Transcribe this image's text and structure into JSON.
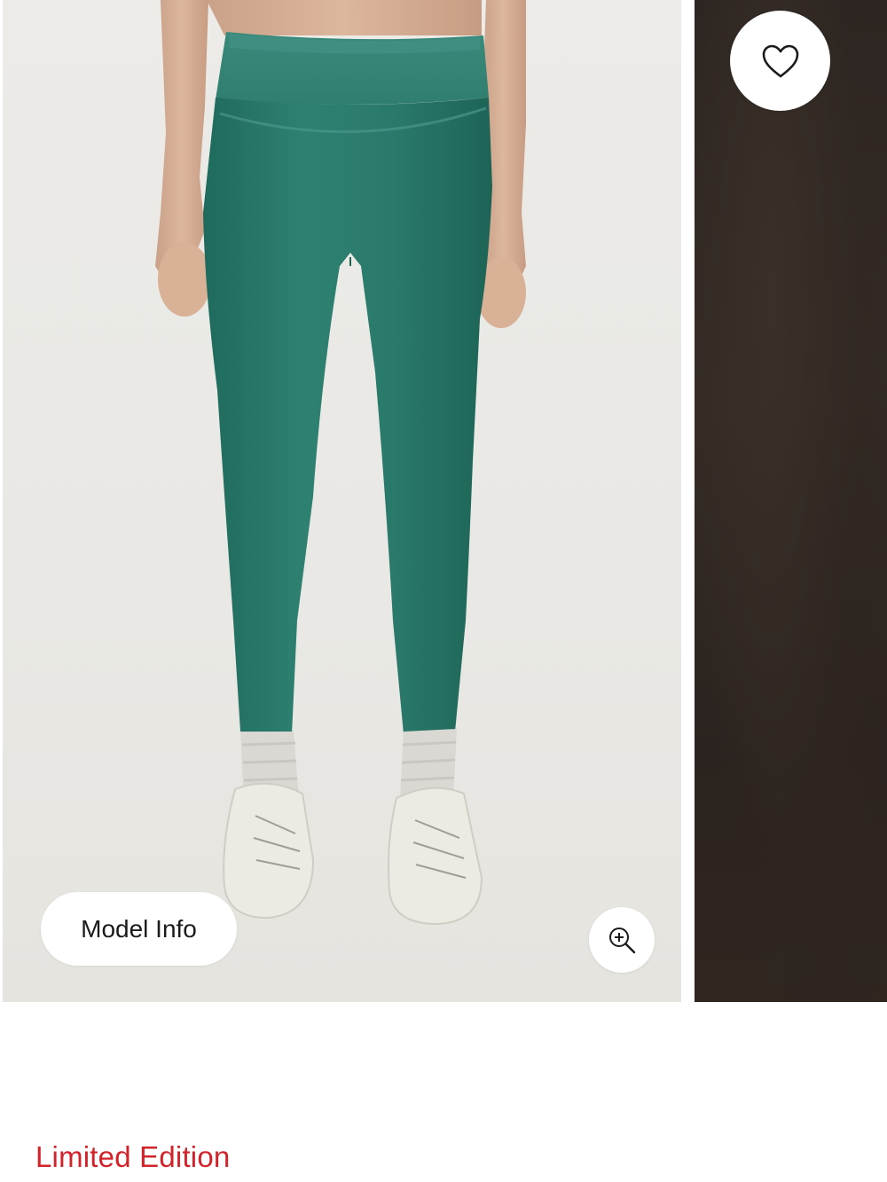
{
  "gallery": {
    "model_info_label": "Model Info",
    "zoom_icon": "zoom-in-icon",
    "wishlist_icon": "heart-icon",
    "current_image_alt": "Green leggings product photo",
    "next_image_alt": "Next product photo"
  },
  "product": {
    "badge": "Limited Edition"
  },
  "colors": {
    "badge": "#d2232a",
    "legging": "#2b7a6c",
    "button_bg": "#ffffff",
    "next_slide_bg": "#2d2521"
  }
}
